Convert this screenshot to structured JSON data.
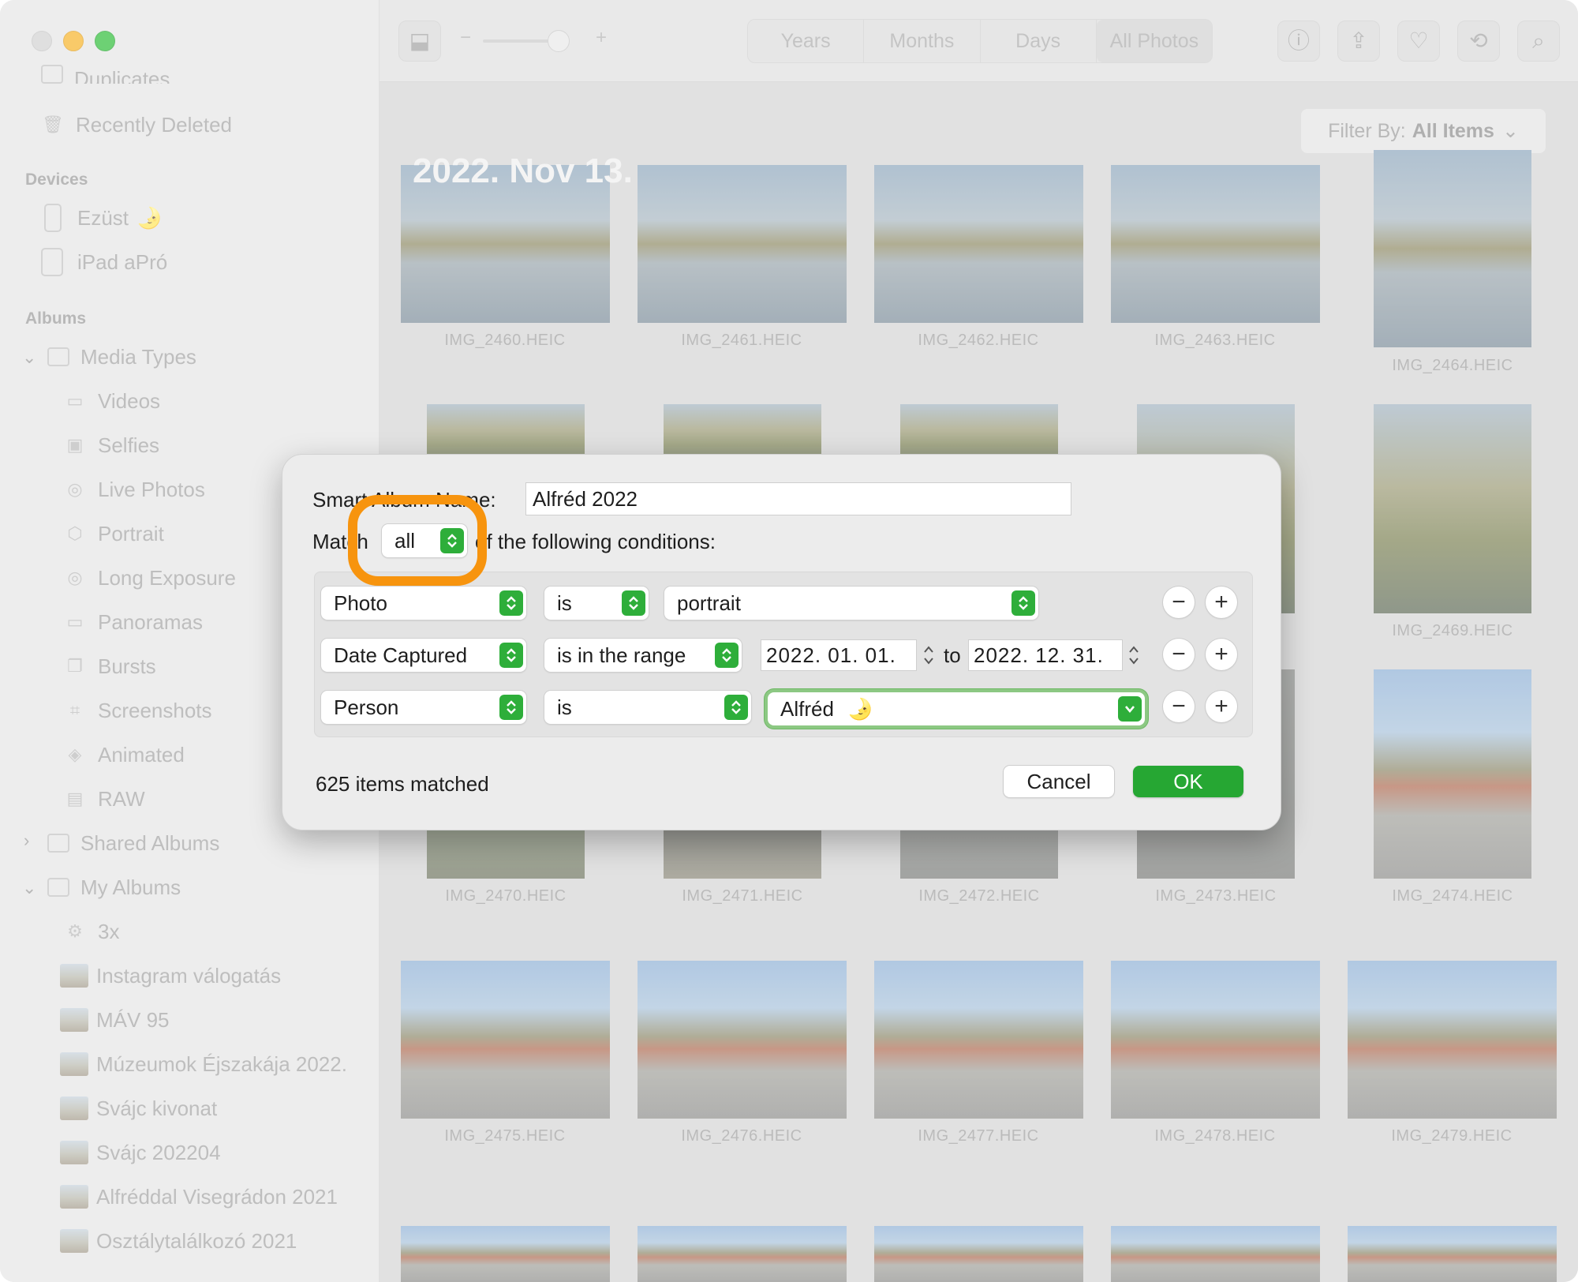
{
  "sidebar": {
    "top_cut_item": "Duplicates",
    "recently_deleted": "Recently Deleted",
    "devices_header": "Devices",
    "devices": [
      {
        "label": "Ezüst",
        "emoji": "🌛"
      },
      {
        "label": "iPad aPró"
      }
    ],
    "albums_header": "Albums",
    "media_types": "Media Types",
    "media_items": [
      "Videos",
      "Selfies",
      "Live Photos",
      "Portrait",
      "Long Exposure",
      "Panoramas",
      "Bursts",
      "Screenshots",
      "Animated",
      "RAW"
    ],
    "shared_albums": "Shared Albums",
    "my_albums": "My Albums",
    "my_album_items": [
      "3x",
      "Instagram válogatás",
      "MÁV 95",
      "Múzeumok Éjszakája 2022.",
      "Svájc kivonat",
      "Svájc 202204",
      "Alfréddal Visegrádon 2021",
      "Osztálytalálkozó 2021"
    ]
  },
  "toolbar": {
    "zoom_minus": "−",
    "zoom_plus": "+",
    "tabs": [
      "Years",
      "Months",
      "Days",
      "All Photos"
    ],
    "active_tab": "All Photos",
    "icons": [
      "info-icon",
      "share-icon",
      "heart-icon",
      "rotate-icon",
      "search-icon"
    ]
  },
  "content": {
    "filter_prefix": "Filter By:",
    "filter_value": "All Items",
    "date_header": "2022. Nov 13.",
    "captions_row1": [
      "IMG_2460.HEIC",
      "IMG_2461.HEIC",
      "IMG_2462.HEIC",
      "IMG_2463.HEIC",
      "IMG_2464.HEIC"
    ],
    "caption_2469": "IMG_2469.HEIC",
    "captions_row3": [
      "IMG_2470.HEIC",
      "IMG_2471.HEIC",
      "IMG_2472.HEIC",
      "IMG_2473.HEIC",
      "IMG_2474.HEIC"
    ],
    "captions_row4": [
      "IMG_2475.HEIC",
      "IMG_2476.HEIC",
      "IMG_2477.HEIC",
      "IMG_2478.HEIC",
      "IMG_2479.HEIC"
    ]
  },
  "dialog": {
    "name_label": "Smart Album Name:",
    "name_value": "Alfréd 2022",
    "match_prefix": "Match",
    "match_value": "all",
    "match_suffix": "of the following conditions:",
    "conditions": [
      {
        "field": "Photo",
        "operator": "is",
        "value": "portrait"
      },
      {
        "field": "Date Captured",
        "operator": "is in the range",
        "from": "2022. 01. 01.",
        "to_label": "to",
        "to": "2022. 12. 31."
      },
      {
        "field": "Person",
        "operator": "is",
        "value": "Alfréd",
        "emoji": "🌛"
      }
    ],
    "remove_symbol": "−",
    "add_symbol": "+",
    "matched_text": "625 items matched",
    "cancel": "Cancel",
    "ok": "OK"
  },
  "colors": {
    "accent_green": "#26a733",
    "highlight_orange": "#f7940e"
  }
}
